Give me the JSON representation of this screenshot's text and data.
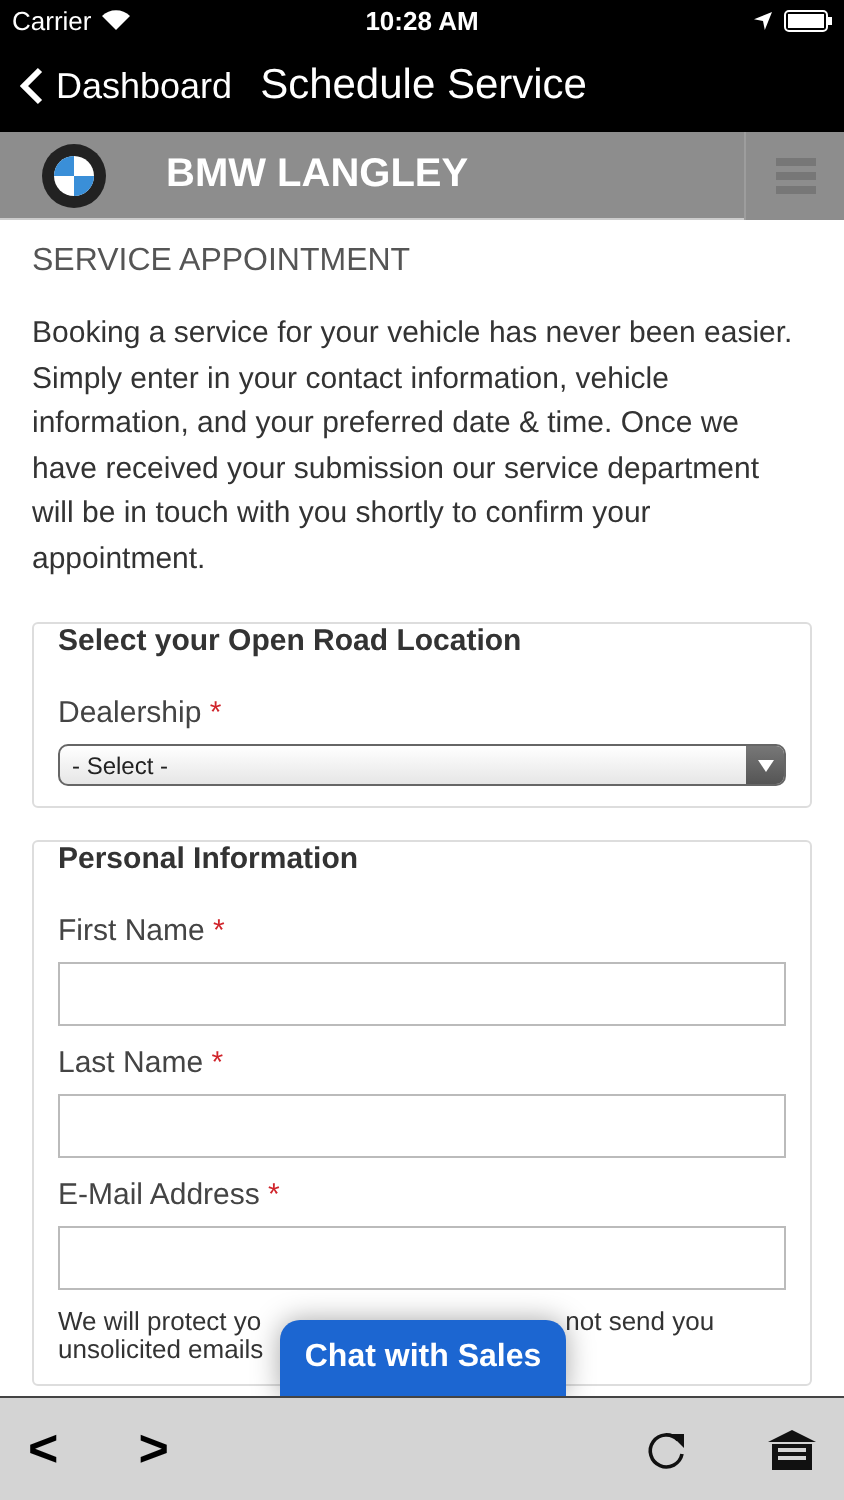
{
  "status_bar": {
    "carrier": "Carrier",
    "time": "10:28 AM"
  },
  "nav_bar": {
    "back": "Dashboard",
    "title": "Schedule Service"
  },
  "brand_bar": {
    "name": "BMW LANGLEY"
  },
  "page": {
    "heading": "SERVICE APPOINTMENT",
    "intro": "Booking a service for your vehicle has never been easier. Simply enter in your contact information, vehicle information, and your preferred date & time.  Once we have received your submission our service department will be in touch with you shortly to confirm your appointment."
  },
  "sections": [
    {
      "legend": "Select your Open Road Location",
      "fields": [
        {
          "kind": "select",
          "label": "Dealership",
          "required": true,
          "value": "- Select -"
        }
      ]
    },
    {
      "legend": "Personal Information",
      "fields": [
        {
          "kind": "text",
          "label": "First Name",
          "required": true
        },
        {
          "kind": "text",
          "label": "Last Name",
          "required": true
        },
        {
          "kind": "text",
          "label": "E-Mail Address",
          "required": true
        }
      ],
      "note_parts": [
        "We will protect yo",
        "not send you",
        "unsolicited emails"
      ]
    }
  ],
  "required_mark": "*",
  "chat_button": "Chat with Sales",
  "toolbar": {
    "back": "<",
    "forward": ">"
  }
}
